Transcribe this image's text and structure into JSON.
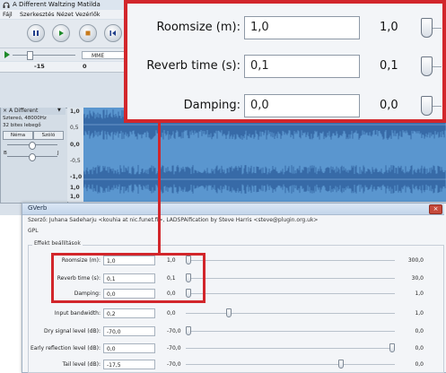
{
  "app": {
    "title": "A Different Waltzing Matilda",
    "menu": [
      "Fájl",
      "Szerkesztés",
      "Nézet",
      "Vezérlők"
    ],
    "host_label": "MME",
    "ruler_mark": "-15",
    "ruler_mark2": "0"
  },
  "track": {
    "name": "A Different",
    "info1": "Sztereó, 48000Hz",
    "info2": "32 bites lebegő",
    "mute": "Néma",
    "solo": "Szóló",
    "left": "B",
    "right": "J",
    "scale": [
      "1,0",
      "0,5",
      "0,0",
      "-0,5",
      "-1,0",
      "1,0",
      "1,0"
    ]
  },
  "dialog": {
    "title": "GVerb",
    "author": "Szerző: Juhana Sadeharju <kouhia at nic.funet.fi>, LADSPAification by Steve Harris <steve@plugin.org.uk>",
    "license": "GPL",
    "group": "Effekt beállítások",
    "rows": [
      {
        "label": "Roomsize (m):",
        "value": "1,0",
        "min": "1,0",
        "max": "300,0",
        "level": 0.0
      },
      {
        "label": "Reverb time (s):",
        "value": "0,1",
        "min": "0,1",
        "max": "30,0",
        "level": 0.0
      },
      {
        "label": "Damping:",
        "value": "0,0",
        "min": "0,0",
        "max": "1,0",
        "level": 0.0
      },
      {
        "label": "Input bandwidth:",
        "value": "0,2",
        "min": "0,0",
        "max": "1,0",
        "level": 0.2
      },
      {
        "label": "Dry signal level (dB):",
        "value": "-70,0",
        "min": "-70,0",
        "max": "0,0",
        "level": 0.0
      },
      {
        "label": "Early reflection level (dB):",
        "value": "0,0",
        "min": "-70,0",
        "max": "0,0",
        "level": 1.0
      },
      {
        "label": "Tail level (dB):",
        "value": "-17,5",
        "min": "-70,0",
        "max": "0,0",
        "level": 0.75
      }
    ]
  },
  "zoom": {
    "rows": [
      {
        "label": "Roomsize (m):",
        "value": "1,0",
        "min": "1,0"
      },
      {
        "label": "Reverb time (s):",
        "value": "0,1",
        "min": "0,1"
      },
      {
        "label": "Damping:",
        "value": "0,0",
        "min": "0,0"
      }
    ]
  },
  "colors": {
    "highlight": "#d2262b",
    "waveform": "#5a96cf"
  }
}
